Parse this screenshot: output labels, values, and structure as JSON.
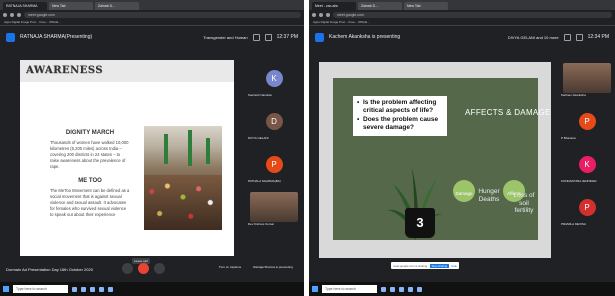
{
  "left": {
    "tabs": [
      "RATNAJA SHARMA",
      "New Tab",
      "Zainab D..."
    ],
    "url": "meet.google.com",
    "bookmarks": "Apps  Digital Image Proc...  Free...  Official...",
    "presenting": "RATNAJA SHARMA(Presenting)",
    "org": "Transgender and Human",
    "clock": "12:37 PM",
    "slide": {
      "title": "AWARENESS",
      "sections": [
        {
          "heading": "DIGNITY MARCH",
          "body": "Thousands of women have walked 10,000 kilometres (6,200 miles) across India – covering 200 districts in 24 states – to raise awareness about the prevalence of rape."
        },
        {
          "heading": "ME TOO",
          "body": "The MeToo Movement can be defined as a social movement that is against sexual violence and sexual assault. It advocates for females who survived sexual violence to speak out about their experience"
        }
      ]
    },
    "participants": [
      {
        "initial": "K",
        "name": "Kamlesh Nandula",
        "color": "#7986cb",
        "video": false
      },
      {
        "initial": "D",
        "name": "DIVYA GELANI",
        "color": "#795548",
        "video": false
      },
      {
        "initial": "P",
        "name": "PATNALA SHARMA(BA)",
        "color": "#e64a19",
        "video": false
      },
      {
        "initial": "",
        "name": "Dev Kishore Kumar",
        "color": "",
        "video": true
      }
    ],
    "meeting_info": "Dormain Ad  Presentation Day 16th October 2020",
    "tooltip": "Leave call",
    "side_labels": [
      {
        "text": "Turn on captions"
      },
      {
        "text": "Ratnaja Sharma is presenting"
      }
    ],
    "search_placeholder": "Type here to search"
  },
  "right": {
    "tabs": [
      "Meet - vac-abc",
      "Zainab D...",
      "New Tab"
    ],
    "url": "meet.google.com",
    "bookmarks": "Apps  Digital Image Proc...  Free...  Official...",
    "presenting": "Kachem Akanksha is presenting",
    "org": "DIVYA GELANI and 10 more",
    "clock": "12:34 PM",
    "slide": {
      "questions": [
        "Is the problem affecting critical aspects of life?",
        "Does the problem cause severe damage?"
      ],
      "title": "AFFECTS & DAMAGE",
      "nodes": [
        {
          "label": "Damage"
        },
        {
          "label": "Affects"
        }
      ],
      "effects": [
        "Hunger Deaths",
        "Loss of soil fertility"
      ],
      "pot_number": "3"
    },
    "participants": [
      {
        "initial": "",
        "name": "Kachem Akanksha",
        "color": "",
        "video": true
      },
      {
        "initial": "P",
        "name": "P Bhavana",
        "color": "#e64a19",
        "video": false
      },
      {
        "initial": "K",
        "name": "KONDAPATRA JENNIFER",
        "color": "#e91e63",
        "video": false
      },
      {
        "initial": "P",
        "name": "PRAMILA DEVISA",
        "color": "#d32f2f",
        "video": false
      }
    ],
    "share_text": "meet.google.com is sharing your screen.",
    "share_button": "Stop sharing",
    "hide_button": "Hide",
    "search_placeholder": "Type here to search"
  }
}
